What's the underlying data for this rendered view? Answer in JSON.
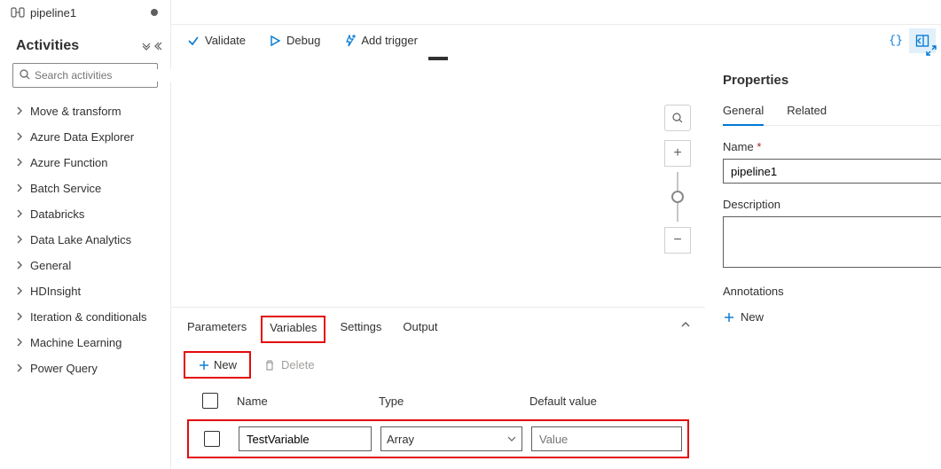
{
  "tab": {
    "title": "pipeline1"
  },
  "sidebar": {
    "title": "Activities",
    "search_placeholder": "Search activities",
    "items": [
      {
        "label": "Move & transform"
      },
      {
        "label": "Azure Data Explorer"
      },
      {
        "label": "Azure Function"
      },
      {
        "label": "Batch Service"
      },
      {
        "label": "Databricks"
      },
      {
        "label": "Data Lake Analytics"
      },
      {
        "label": "General"
      },
      {
        "label": "HDInsight"
      },
      {
        "label": "Iteration & conditionals"
      },
      {
        "label": "Machine Learning"
      },
      {
        "label": "Power Query"
      }
    ]
  },
  "toolbar": {
    "validate": "Validate",
    "debug": "Debug",
    "trigger": "Add trigger"
  },
  "config": {
    "tabs": {
      "parameters": "Parameters",
      "variables": "Variables",
      "settings": "Settings",
      "output": "Output"
    },
    "new_label": "New",
    "delete_label": "Delete",
    "columns": {
      "name": "Name",
      "type": "Type",
      "default": "Default value"
    },
    "row": {
      "name": "TestVariable",
      "type": "Array",
      "default_placeholder": "Value"
    }
  },
  "props": {
    "title": "Properties",
    "tabs": {
      "general": "General",
      "related": "Related"
    },
    "name_label": "Name",
    "name_value": "pipeline1",
    "desc_label": "Description",
    "desc_value": "",
    "ann_label": "Annotations",
    "ann_new": "New"
  }
}
